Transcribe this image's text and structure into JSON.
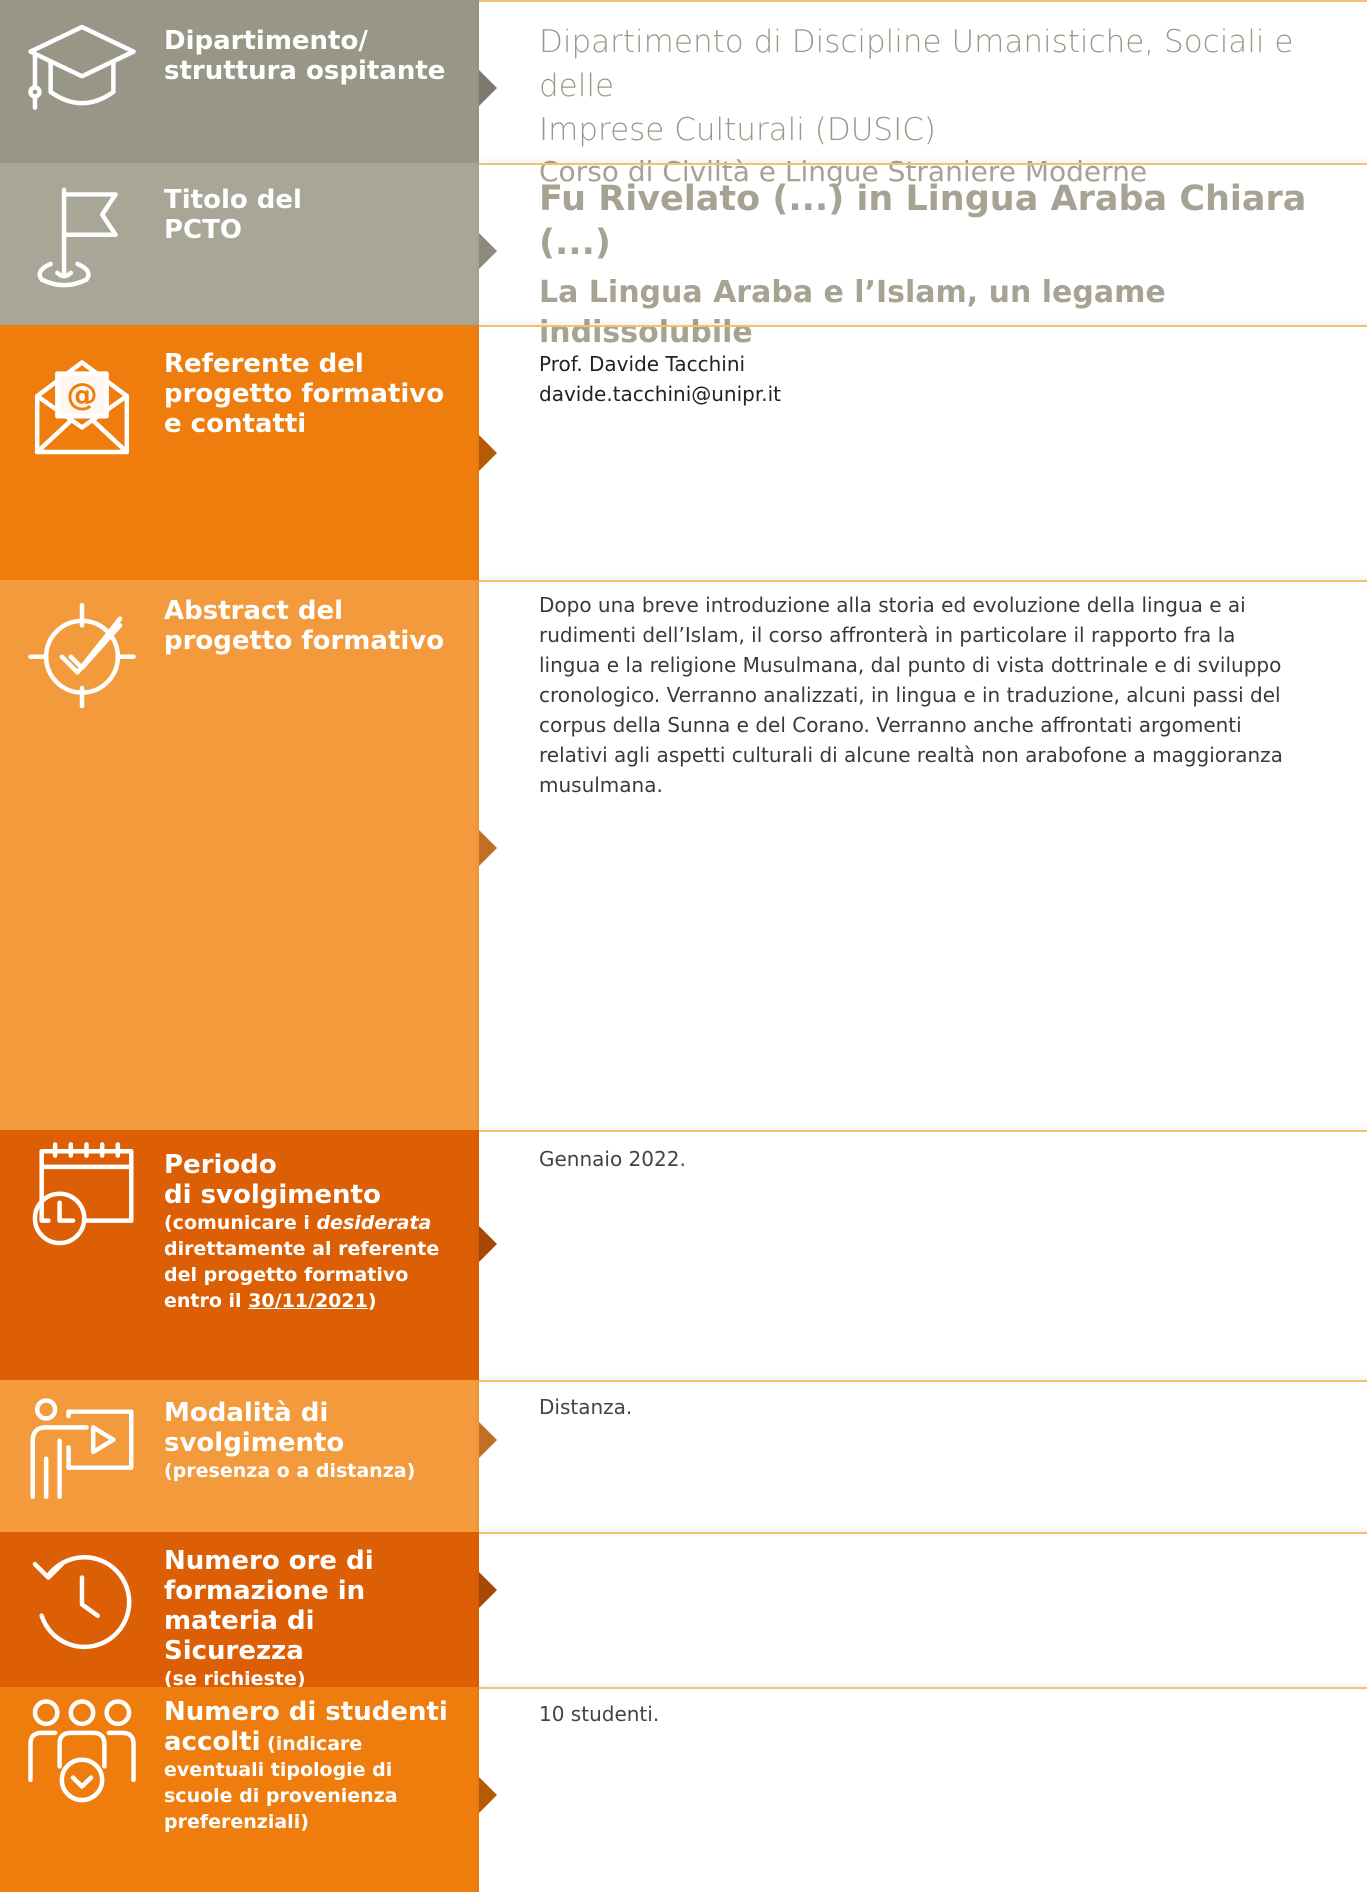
{
  "colors": {
    "gray": "#989686",
    "orange": "#ef7d0e",
    "light_orange": "#f29a3c",
    "dark_orange": "#dc5f05",
    "rule": "#f2c36b"
  },
  "rows": {
    "department": {
      "icon": "graduation-cap-icon",
      "label_line1": "Dipartimento/",
      "label_line2": "struttura ospitante",
      "value_line1": "Dipartimento di Discipline Umanistiche, Sociali e delle",
      "value_line2": "Imprese Culturali (DUSIC)",
      "value_line3": "Corso di Civiltà e Lingue Straniere Moderne"
    },
    "title": {
      "icon": "flag-icon",
      "label_line1": "Titolo del",
      "label_line2": "PCTO",
      "value_line1": "Fu Rivelato (...) in Lingua Araba Chiara (...)",
      "value_line2": "La Lingua Araba e l’Islam, un legame indissolubile"
    },
    "referent": {
      "icon": "email-envelope-icon",
      "label_line1": "Referente del",
      "label_line2": "progetto formativo",
      "label_line3": "e contatti",
      "value_name": "Prof. Davide Tacchini",
      "value_email": "davide.tacchini@unipr.it"
    },
    "abstract": {
      "icon": "target-check-icon",
      "label_line1": "Abstract del",
      "label_line2": "progetto formativo",
      "value_lines": [
        "Dopo una breve introduzione alla storia ed evoluzione della lingua e ai",
        "rudimenti dell’Islam, il corso affronterà in particolare il rapporto fra la",
        "lingua e la religione Musulmana, dal punto di vista dottrinale e di sviluppo",
        "cronologico. Verranno analizzati, in lingua e in traduzione, alcuni passi del",
        "corpus della Sunna e del Corano. Verranno anche affrontati argomenti",
        "relativi agli aspetti culturali di alcune realtà non arabofone a maggioranza",
        "musulmana."
      ]
    },
    "period": {
      "icon": "calendar-clock-icon",
      "label_line1": "Periodo",
      "label_line2": "di svolgimento",
      "sub_line1_a": "(comunicare i ",
      "sub_line1_b": "desiderata",
      "sub_line2": "direttamente al referente",
      "sub_line3": "del progetto formativo",
      "sub_line4_a": "entro il ",
      "sub_line4_b": "30/11/2021",
      "sub_line4_c": ")",
      "value": "Gennaio 2022."
    },
    "mode": {
      "icon": "presenter-screen-icon",
      "label_line1": "Modalità di",
      "label_line2": "svolgimento",
      "sub_line1": "(presenza o a distanza)",
      "value": "Distanza."
    },
    "hours": {
      "icon": "history-clock-icon",
      "label_line1": "Numero ore di",
      "label_line2": "formazione in",
      "label_line3": "materia di Sicurezza",
      "sub_line1": "(se richieste)",
      "value": ""
    },
    "students": {
      "icon": "group-people-icon",
      "label_line1": "Numero di studenti",
      "label_line2_a": "accolti",
      "label_line2_b": " (indicare",
      "sub_line1": "eventuali tipologie di",
      "sub_line2": "scuole di provenienza",
      "sub_line3": "preferenziali)",
      "value": "10 studenti."
    }
  }
}
